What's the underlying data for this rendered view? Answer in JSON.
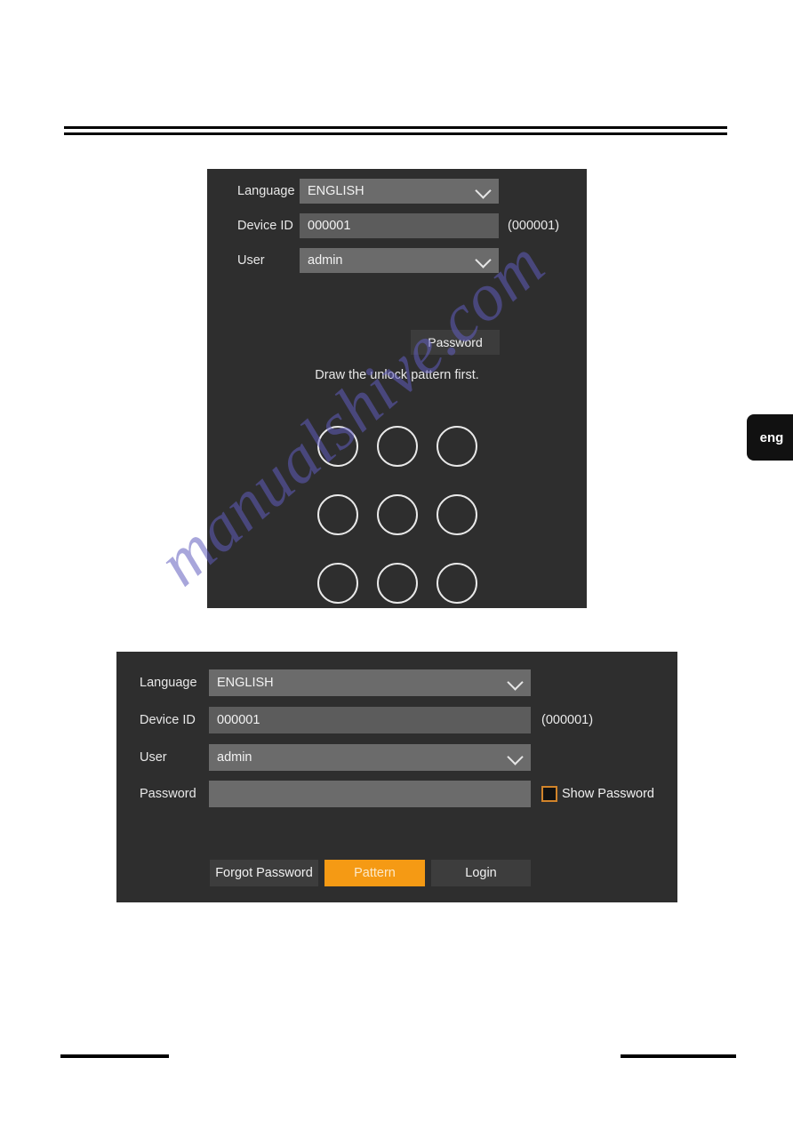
{
  "page": {
    "language_tab": "eng",
    "watermark": "manualshive.com"
  },
  "pattern_panel": {
    "fields": {
      "language": {
        "label": "Language",
        "value": "ENGLISH"
      },
      "device_id": {
        "label": "Device ID",
        "value": "000001",
        "hint": "(000001)"
      },
      "user": {
        "label": "User",
        "value": "admin"
      }
    },
    "password_button": "Password",
    "instruction": "Draw the unlock pattern first.",
    "pattern_dots": [
      "dot-1",
      "dot-2",
      "dot-3",
      "dot-4",
      "dot-5",
      "dot-6",
      "dot-7",
      "dot-8",
      "dot-9"
    ]
  },
  "login_panel": {
    "fields": {
      "language": {
        "label": "Language",
        "value": "ENGLISH"
      },
      "device_id": {
        "label": "Device ID",
        "value": "000001",
        "hint": "(000001)"
      },
      "user": {
        "label": "User",
        "value": "admin"
      },
      "password": {
        "label": "Password",
        "value": "",
        "placeholder": ""
      }
    },
    "show_password": {
      "label": "Show Password",
      "checked": false
    },
    "buttons": {
      "forgot": "Forgot Password",
      "pattern": "Pattern",
      "login": "Login"
    }
  },
  "colors": {
    "panel_bg": "#2e2e2e",
    "input_bg": "#6b6b6b",
    "text_input_bg": "#5c5c5c",
    "accent_orange": "#f59a14",
    "checkbox_border": "#d1842a",
    "watermark": "#605cbe"
  }
}
